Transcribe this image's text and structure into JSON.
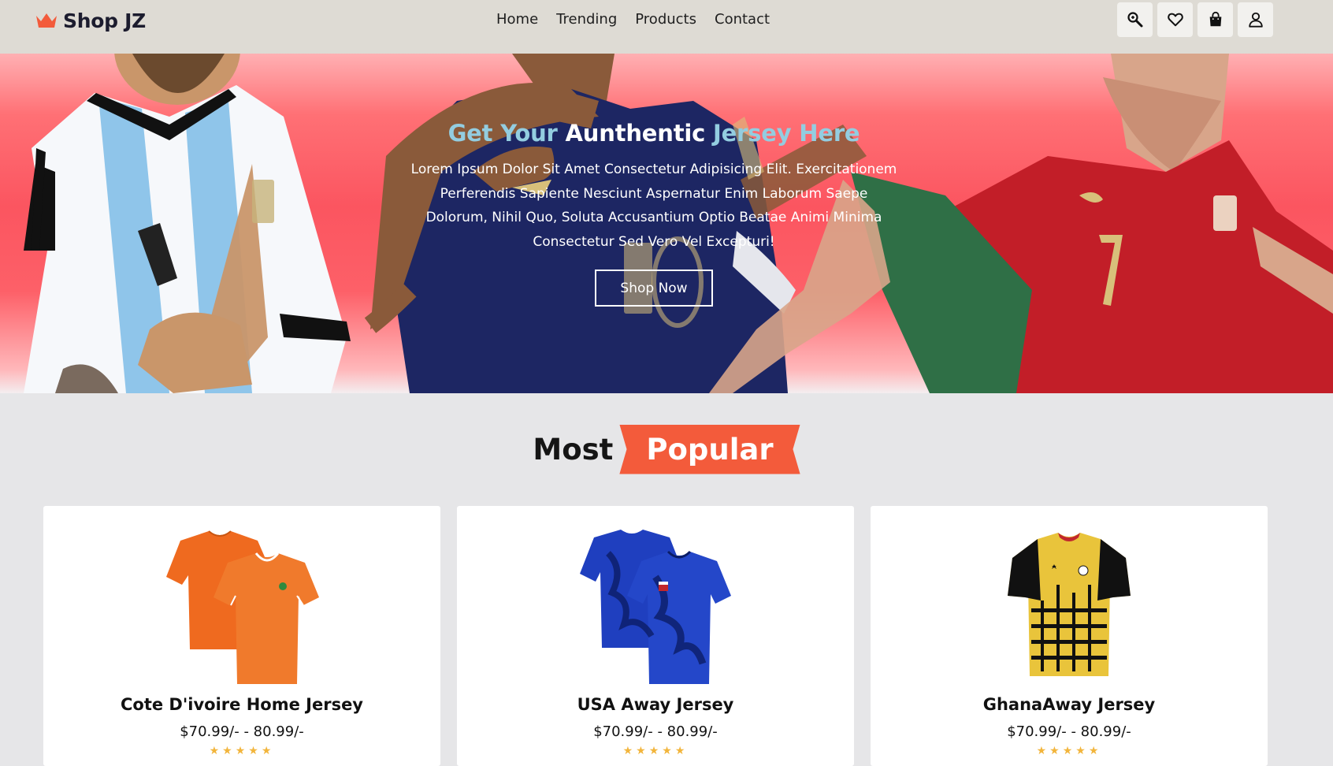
{
  "brand": {
    "name": "Shop JZ",
    "logo_icon": "crown-icon",
    "accent": "#f35b3b"
  },
  "nav": {
    "items": [
      {
        "label": "Home"
      },
      {
        "label": "Trending"
      },
      {
        "label": "Products"
      },
      {
        "label": "Contact"
      }
    ]
  },
  "header_icons": [
    "search-icon",
    "heart-icon",
    "bag-icon",
    "user-icon"
  ],
  "hero": {
    "title_part1": "Get Your",
    "title_part2": "Aunthentic",
    "title_part3": "Jersey Here",
    "description": "Lorem Ipsum Dolor Sit Amet Consectetur Adipisicing Elit. Exercitationem Perferendis Sapiente Nesciunt Aspernatur Enim Laborum Saepe Dolorum, Nihil Quo, Soluta Accusantium Optio Beatae Animi Minima Consectetur Sed Vero Vel Excepturi!",
    "button_label": "Shop Now"
  },
  "section": {
    "title_part1": "Most",
    "title_part2": "Popular"
  },
  "products": [
    {
      "name": "Cote D'ivoire Home Jersey",
      "price": "$70.99/- - 80.99/-",
      "stars": "★★★★★"
    },
    {
      "name": "USA Away Jersey",
      "price": "$70.99/- - 80.99/-",
      "stars": "★★★★★"
    },
    {
      "name": "GhanaAway Jersey",
      "price": "$70.99/- - 80.99/-",
      "stars": "★★★★★"
    }
  ]
}
